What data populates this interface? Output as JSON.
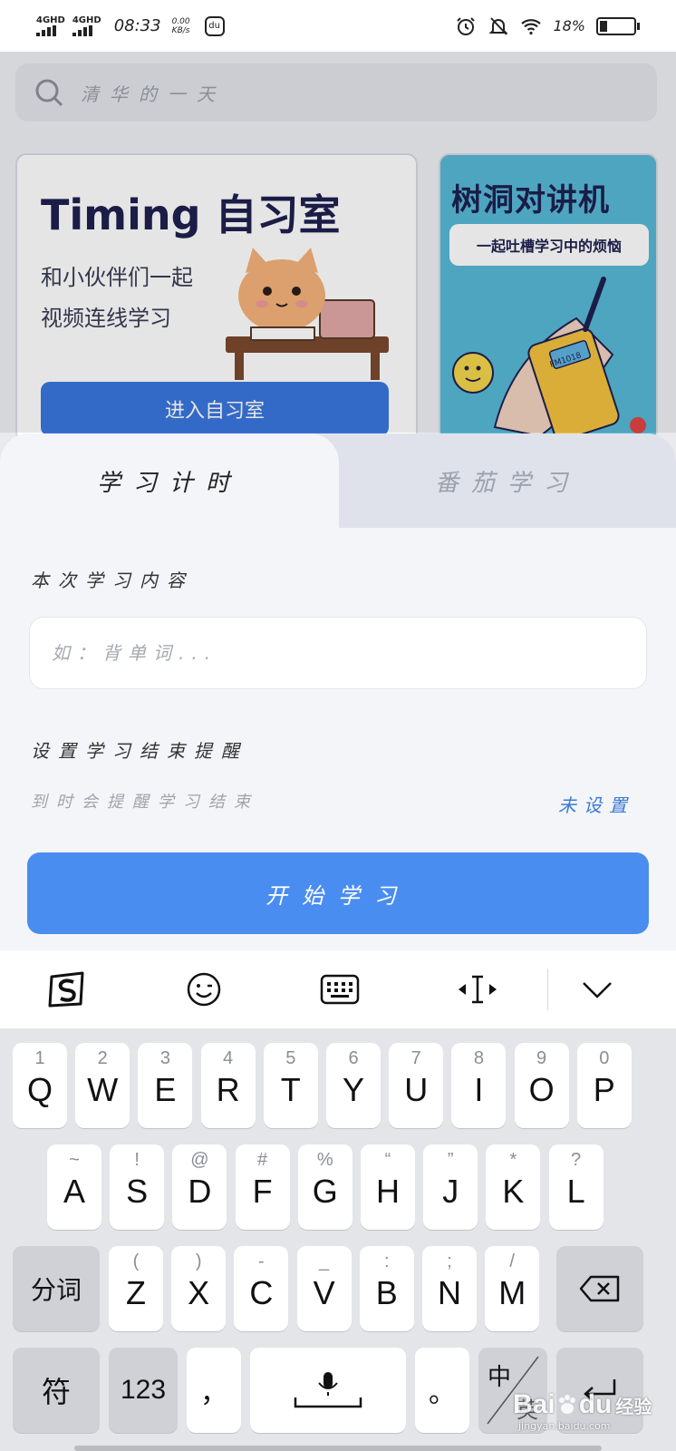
{
  "status_bar": {
    "sim1": "4GHD",
    "sim2": "4GHD",
    "time": "08:33",
    "speed_value": "0.00",
    "speed_unit": "KB/s",
    "battery": "18%"
  },
  "background_app": {
    "search_placeholder": "清华的一天",
    "timing_card": {
      "title": "Timing 自习室",
      "subtitle_line1": "和小伙伴们一起",
      "subtitle_line2": "视频连线学习",
      "enter_button": "进入自习室"
    },
    "walkie_card": {
      "title": "树洞对讲机",
      "subtitle": "一起吐槽学习中的烦恼",
      "device_label": "FM1018"
    }
  },
  "sheet": {
    "tabs": [
      {
        "label": "学习计时",
        "active": true
      },
      {
        "label": "番茄学习",
        "active": false
      }
    ],
    "study_content_label": "本次学习内容",
    "study_input_placeholder": "如：背单词...",
    "remind_label": "设置学习结束提醒",
    "remind_desc": "到时会提醒学习结束",
    "remind_value": "未设置",
    "start_button": "开始学习"
  },
  "keyboard": {
    "row1": [
      {
        "main": "Q",
        "hint": "1"
      },
      {
        "main": "W",
        "hint": "2"
      },
      {
        "main": "E",
        "hint": "3"
      },
      {
        "main": "R",
        "hint": "4"
      },
      {
        "main": "T",
        "hint": "5"
      },
      {
        "main": "Y",
        "hint": "6"
      },
      {
        "main": "U",
        "hint": "7"
      },
      {
        "main": "I",
        "hint": "8"
      },
      {
        "main": "O",
        "hint": "9"
      },
      {
        "main": "P",
        "hint": "0"
      }
    ],
    "row2": [
      {
        "main": "A",
        "hint": "~"
      },
      {
        "main": "S",
        "hint": "!"
      },
      {
        "main": "D",
        "hint": "@"
      },
      {
        "main": "F",
        "hint": "#"
      },
      {
        "main": "G",
        "hint": "%"
      },
      {
        "main": "H",
        "hint": "“"
      },
      {
        "main": "J",
        "hint": "”"
      },
      {
        "main": "K",
        "hint": "*"
      },
      {
        "main": "L",
        "hint": "?"
      }
    ],
    "row3": [
      {
        "main": "Z",
        "hint": "("
      },
      {
        "main": "X",
        "hint": ")"
      },
      {
        "main": "C",
        "hint": "-"
      },
      {
        "main": "V",
        "hint": "_"
      },
      {
        "main": "B",
        "hint": ":"
      },
      {
        "main": "N",
        "hint": ";"
      },
      {
        "main": "M",
        "hint": "/"
      }
    ],
    "segment_key": "分词",
    "symbol_key": "符",
    "number_key": "123",
    "comma_key": "，",
    "period_key": "。",
    "lang_key": "中",
    "lang_key_sub": "英"
  },
  "watermark": {
    "brand": "Bai",
    "brand2": "du",
    "suffix": "经验",
    "url": "jingyan.baidu.com"
  }
}
